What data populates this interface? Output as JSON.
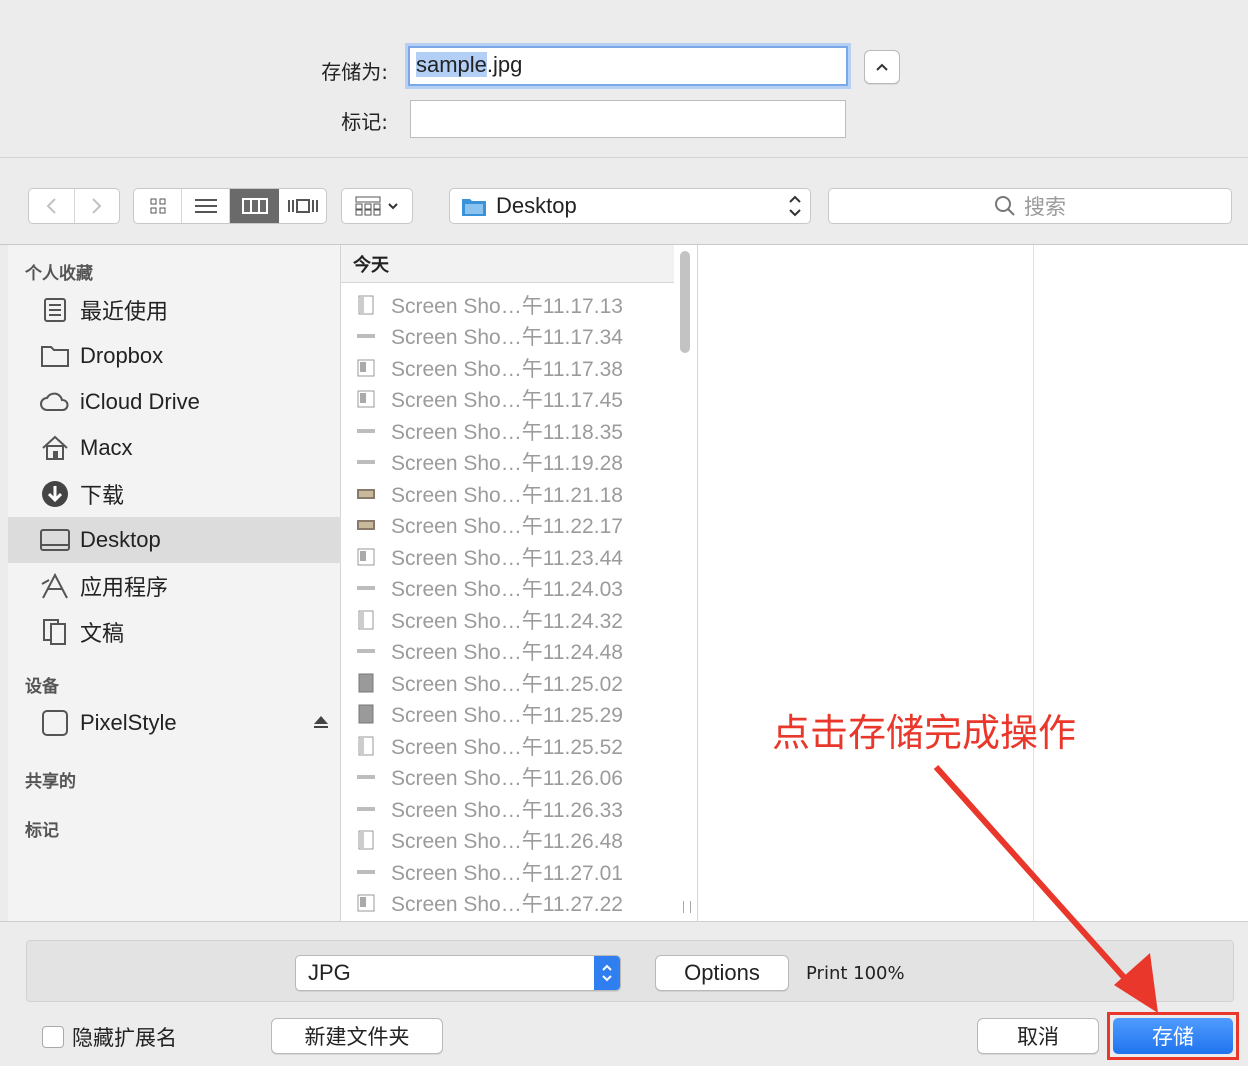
{
  "header": {
    "save_as_label": "存储为:",
    "save_as_value_selected": "sample",
    "save_as_value_rest": ".jpg",
    "tags_label": "标记:",
    "tags_value": ""
  },
  "toolbar": {
    "location": "Desktop",
    "search_placeholder": "搜索"
  },
  "sidebar": {
    "favorites_header": "个人收藏",
    "favorites": [
      {
        "label": "最近使用",
        "icon": "recents-icon"
      },
      {
        "label": "Dropbox",
        "icon": "folder-icon"
      },
      {
        "label": "iCloud Drive",
        "icon": "cloud-icon"
      },
      {
        "label": "Macx",
        "icon": "home-icon"
      },
      {
        "label": "下载",
        "icon": "download-icon"
      },
      {
        "label": "Desktop",
        "icon": "desktop-icon",
        "selected": true
      },
      {
        "label": "应用程序",
        "icon": "applications-icon"
      },
      {
        "label": "文稿",
        "icon": "documents-icon"
      }
    ],
    "devices_header": "设备",
    "devices": [
      {
        "label": "PixelStyle",
        "icon": "disk-icon"
      }
    ],
    "shared_header": "共享的",
    "tags_header": "标记"
  },
  "file_list": {
    "header": "今天",
    "files": [
      "Screen Sho…午11.17.13",
      "Screen Sho…午11.17.34",
      "Screen Sho…午11.17.38",
      "Screen Sho…午11.17.45",
      "Screen Sho…午11.18.35",
      "Screen Sho…午11.19.28",
      "Screen Sho…午11.21.18",
      "Screen Sho…午11.22.17",
      "Screen Sho…午11.23.44",
      "Screen Sho…午11.24.03",
      "Screen Sho…午11.24.32",
      "Screen Sho…午11.24.48",
      "Screen Sho…午11.25.02",
      "Screen Sho…午11.25.29",
      "Screen Sho…午11.25.52",
      "Screen Sho…午11.26.06",
      "Screen Sho…午11.26.33",
      "Screen Sho…午11.26.48",
      "Screen Sho…午11.27.01",
      "Screen Sho…午11.27.22"
    ]
  },
  "bottom": {
    "format_value": "JPG",
    "options_label": "Options",
    "print_label": "Print 100%",
    "hide_extension_label": "隐藏扩展名",
    "new_folder_label": "新建文件夹",
    "cancel_label": "取消",
    "save_label": "存储"
  },
  "annotation": {
    "text": "点击存储完成操作",
    "color": "#e9382b"
  },
  "colors": {
    "accent": "#2f7ff0",
    "highlight_box": "#e9382b"
  }
}
